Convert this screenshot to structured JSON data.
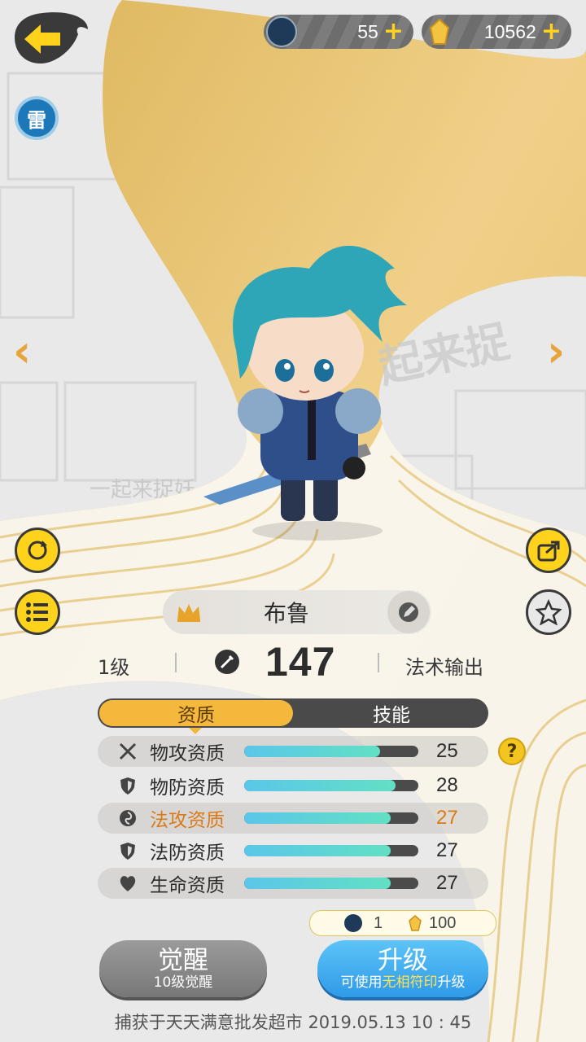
{
  "currency": {
    "gem_count": "55",
    "gold_count": "10562"
  },
  "element_badge": "雷",
  "watermark_text": "一起来捉妖",
  "pet": {
    "name": "布鲁",
    "level": "1级",
    "power": "147",
    "role": "法术输出"
  },
  "tabs": [
    "资质",
    "技能"
  ],
  "attributes": [
    {
      "label": "物攻资质",
      "value": "25",
      "icon": "crossed-swords-icon",
      "fill": 0.78
    },
    {
      "label": "物防资质",
      "value": "28",
      "icon": "shield-icon",
      "fill": 0.87
    },
    {
      "label": "法攻资质",
      "value": "27",
      "icon": "swirl-icon",
      "fill": 0.84
    },
    {
      "label": "法防资质",
      "value": "27",
      "icon": "shield-icon",
      "fill": 0.84
    },
    {
      "label": "生命资质",
      "value": "27",
      "icon": "heart-icon",
      "fill": 0.84
    }
  ],
  "help_label": "?",
  "upgrade_cost": {
    "gems": "1",
    "gold": "100"
  },
  "buttons": {
    "awaken": "觉醒",
    "awaken_sub": "10级觉醒",
    "upgrade": "升级",
    "upgrade_sub_prefix": "可使用",
    "upgrade_sub_highlight": "无相符印",
    "upgrade_sub_suffix": "升级"
  },
  "capture_info": "捕获于天天满意批发超市  2019.05.13   10 : 45",
  "colors": {
    "accent_yellow": "#ffd21c",
    "tab_active": "#f3b83c",
    "highlight_orange": "#d97a18",
    "upgrade_blue": "#2f9ae8",
    "rune_highlight": "#ffe15a"
  }
}
